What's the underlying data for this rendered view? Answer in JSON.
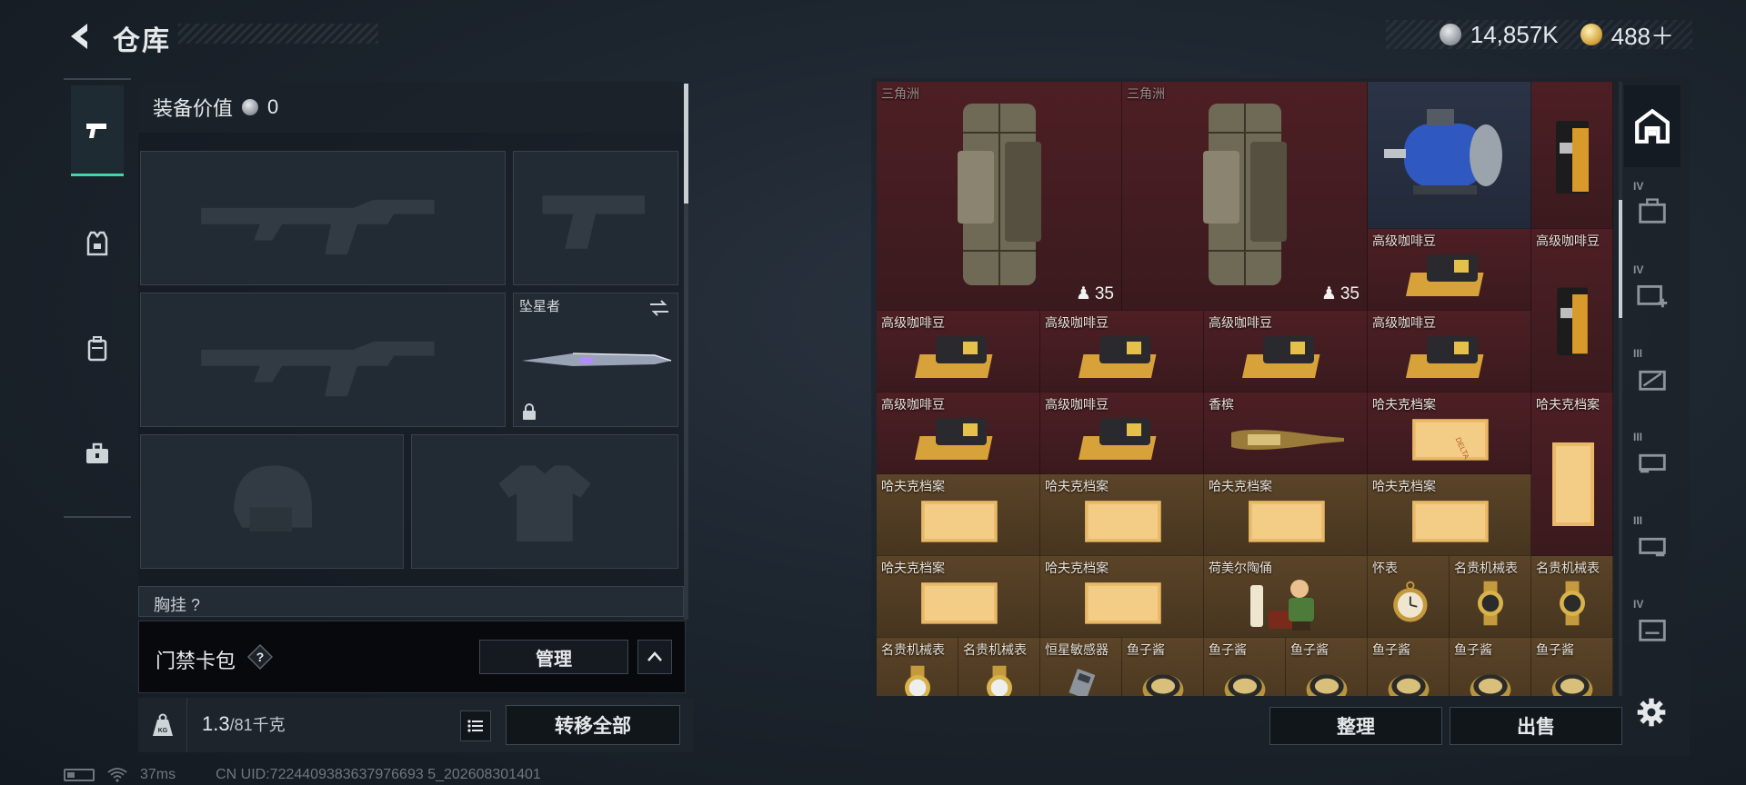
{
  "header": {
    "title": "仓库",
    "currencies": [
      {
        "icon": "silver-coin-icon",
        "value": "14,857K"
      },
      {
        "icon": "gold-coin-icon",
        "value": "488＋"
      }
    ]
  },
  "rail": {
    "items": [
      {
        "name": "weapons",
        "icon": "pistol-icon",
        "active": true
      },
      {
        "name": "armor",
        "icon": "vest-icon",
        "active": false
      },
      {
        "name": "backpack",
        "icon": "backpack-icon",
        "active": false
      },
      {
        "name": "toolbox",
        "icon": "toolbox-icon",
        "active": false
      }
    ]
  },
  "equipment": {
    "value_label": "装备价值",
    "value": "0",
    "melee_name": "坠星者",
    "chest_label": "胸挂",
    "chest_count": "?"
  },
  "keycard": {
    "label": "门禁卡包",
    "help": "?",
    "manage": "管理"
  },
  "weight": {
    "current": "1.3",
    "max": "/81千克",
    "transfer_all": "转移全部"
  },
  "status": {
    "ping": "37ms",
    "uid": "CN UID:7224409383637976693 5_202608301401"
  },
  "stash": {
    "backpack_tag": "三角洲",
    "backpack_count": "35",
    "items": {
      "coffee": "高级咖啡豆",
      "champagne": "香槟",
      "dossier": "哈夫克档案",
      "figurine": "荷美尔陶俑",
      "pocket_watch": "怀表",
      "luxury_watch": "名贵机械表",
      "sensor": "恒星敏感器",
      "caviar": "鱼子酱"
    },
    "sort": "整理",
    "sell": "出售"
  },
  "crates": [
    {
      "icon": "home-stash-icon",
      "tier": ""
    },
    {
      "icon": "case-icon",
      "tier": "IV"
    },
    {
      "icon": "case-add-icon",
      "tier": "IV"
    },
    {
      "icon": "case-icon",
      "tier": "III"
    },
    {
      "icon": "case-icon",
      "tier": "III"
    },
    {
      "icon": "case-icon",
      "tier": "III"
    },
    {
      "icon": "case-icon",
      "tier": "IV"
    }
  ],
  "colors": {
    "accent": "#3ed7a8",
    "red_cell": "#4d1f24",
    "gold_cell": "#5b4428"
  }
}
